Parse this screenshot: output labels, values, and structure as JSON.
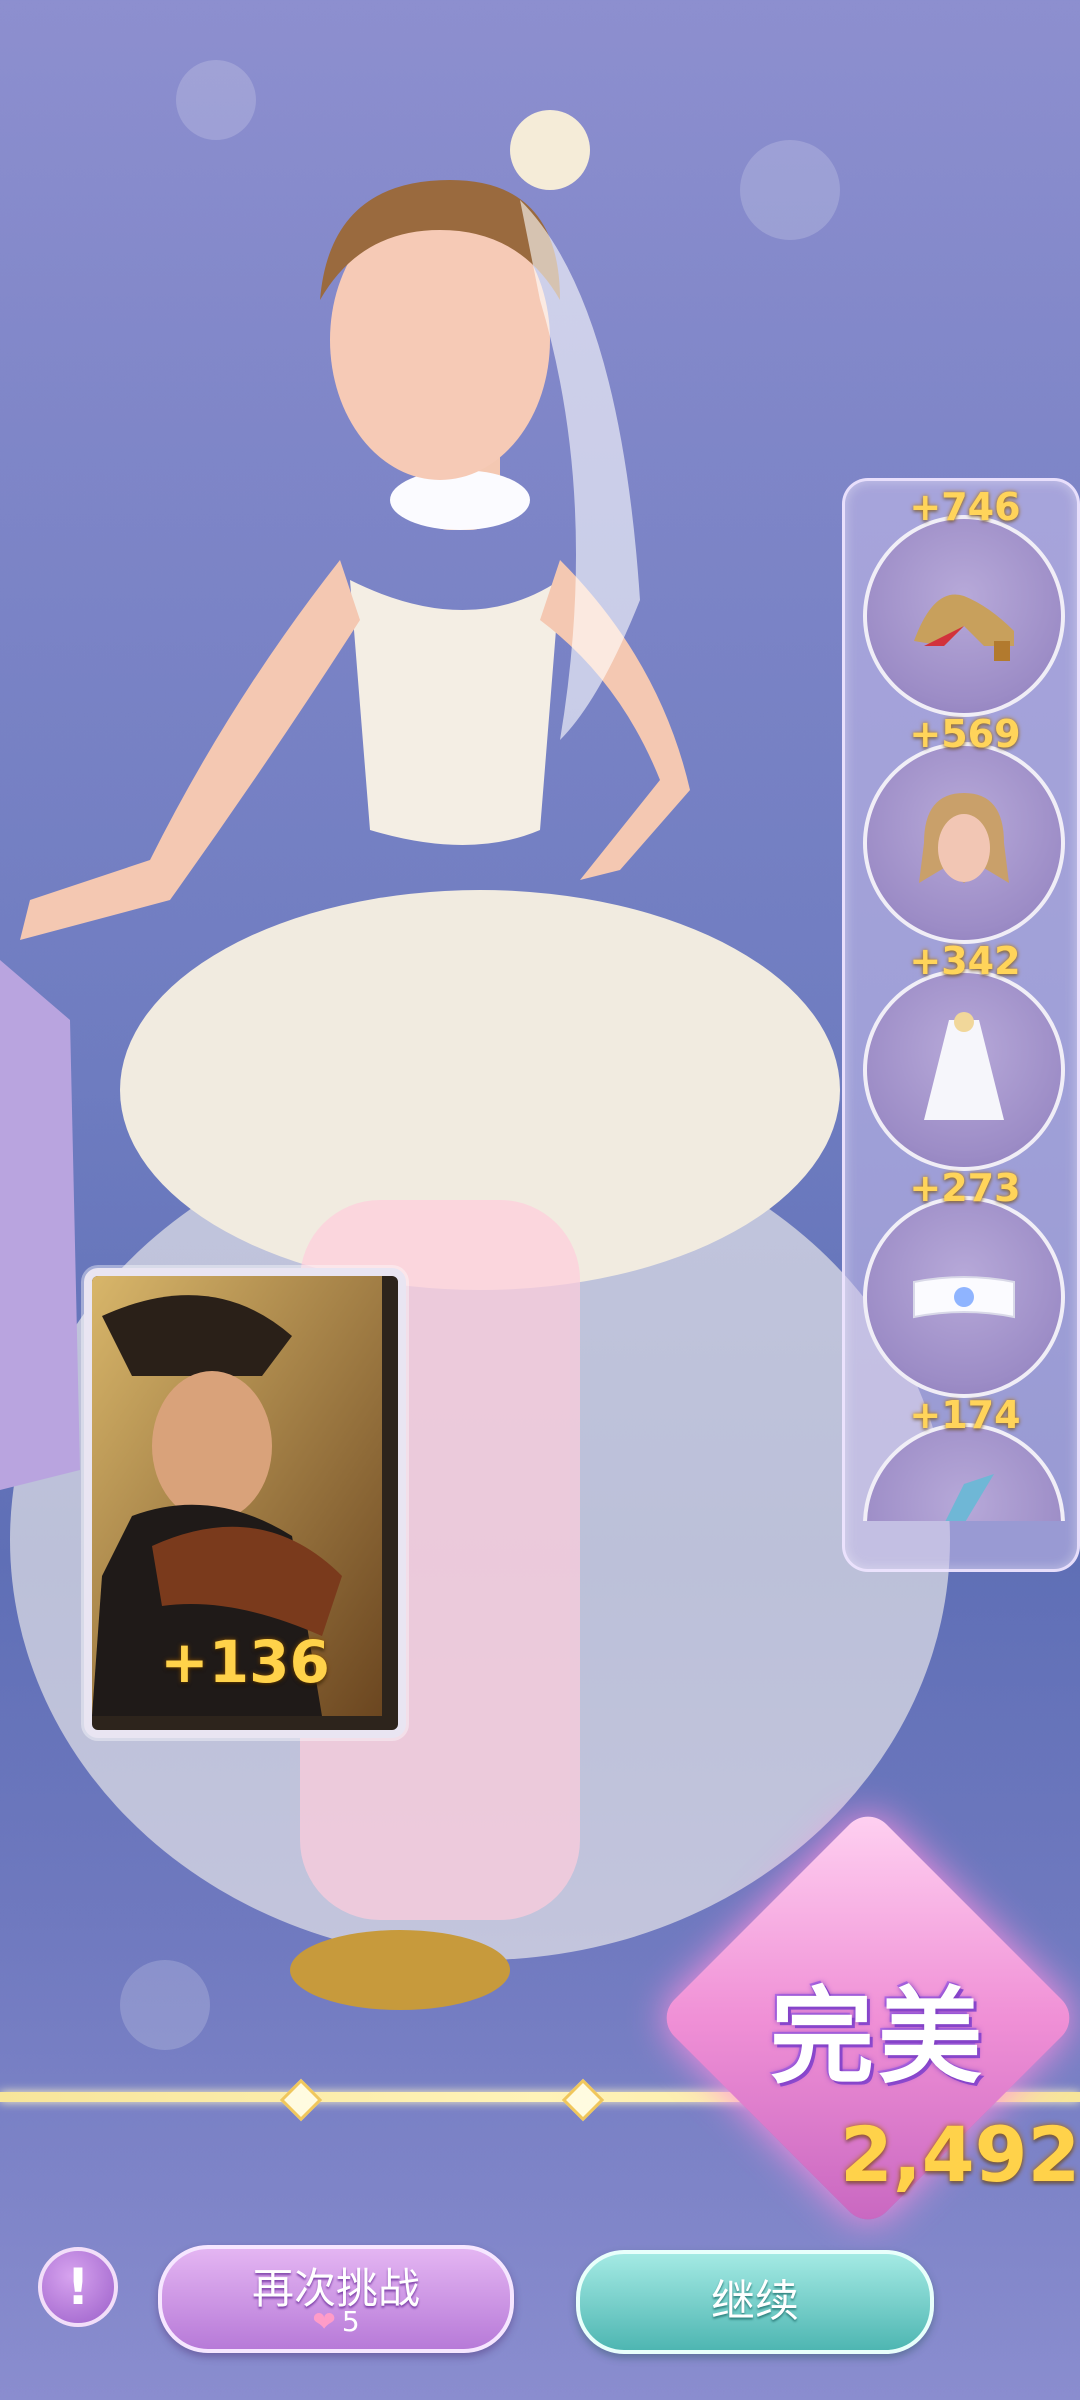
{
  "items": [
    {
      "score": "+746",
      "icon": "high-heel-shoes-icon"
    },
    {
      "score": "+569",
      "icon": "hairstyle-icon"
    },
    {
      "score": "+342",
      "icon": "veil-icon"
    },
    {
      "score": "+273",
      "icon": "bow-choker-icon"
    },
    {
      "score": "+174",
      "icon": "butterfly-ring-icon"
    }
  ],
  "card": {
    "score": "+136"
  },
  "rating": {
    "label": "完美",
    "total": "2,492"
  },
  "buttons": {
    "info": "!",
    "retry_label": "再次挑战",
    "retry_cost": "5",
    "continue_label": "继续"
  },
  "colors": {
    "score_gold": "#ffd24a",
    "retry_purple": "#b77ad8",
    "continue_teal": "#4eb6b2"
  }
}
